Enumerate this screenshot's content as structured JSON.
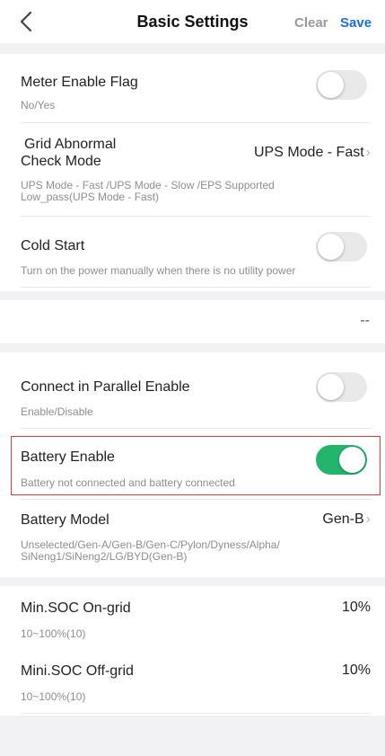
{
  "header": {
    "title": "Basic Settings",
    "back_icon": "chevron-left-icon",
    "clear_label": "Clear",
    "save_label": "Save"
  },
  "colors": {
    "accent": "#1a6fd8",
    "toggle_on": "#23b56c",
    "highlight_border": "#e03b3b",
    "background": "#f2f2f4"
  },
  "settings": {
    "meter_enable": {
      "label": "Meter Enable Flag",
      "sub": "No/Yes",
      "enabled": false
    },
    "grid_abnormal": {
      "label_line1": "Grid Abnormal",
      "label_line2": "Check Mode",
      "value": "UPS Mode - Fast",
      "sub_line1": "UPS Mode - Fast /UPS Mode - Slow /EPS Supported",
      "sub_line2": "Low_pass(UPS Mode - Fast)"
    },
    "cold_start": {
      "label": "Cold Start",
      "sub": "Turn on the power manually when there is no utility power",
      "enabled": false
    },
    "empty_value": "--",
    "parallel": {
      "label": "Connect in Parallel Enable",
      "sub": "Enable/Disable",
      "enabled": false
    },
    "battery_enable": {
      "label": "Battery Enable",
      "sub": "Battery not connected and battery connected",
      "enabled": true
    },
    "battery_model": {
      "label": "Battery Model",
      "value": "Gen-B",
      "sub_line1": "Unselected/Gen-A/Gen-B/Gen-C/Pylon/Dyness/Alpha/",
      "sub_line2": "SiNeng1/SiNeng2/LG/BYD(Gen-B)"
    },
    "min_soc_on": {
      "label": "Min.SOC On-grid",
      "value": "10%",
      "sub": "10~100%(10)"
    },
    "min_soc_off": {
      "label": "Mini.SOC Off-grid",
      "value": "10%",
      "sub": "10~100%(10)"
    }
  }
}
